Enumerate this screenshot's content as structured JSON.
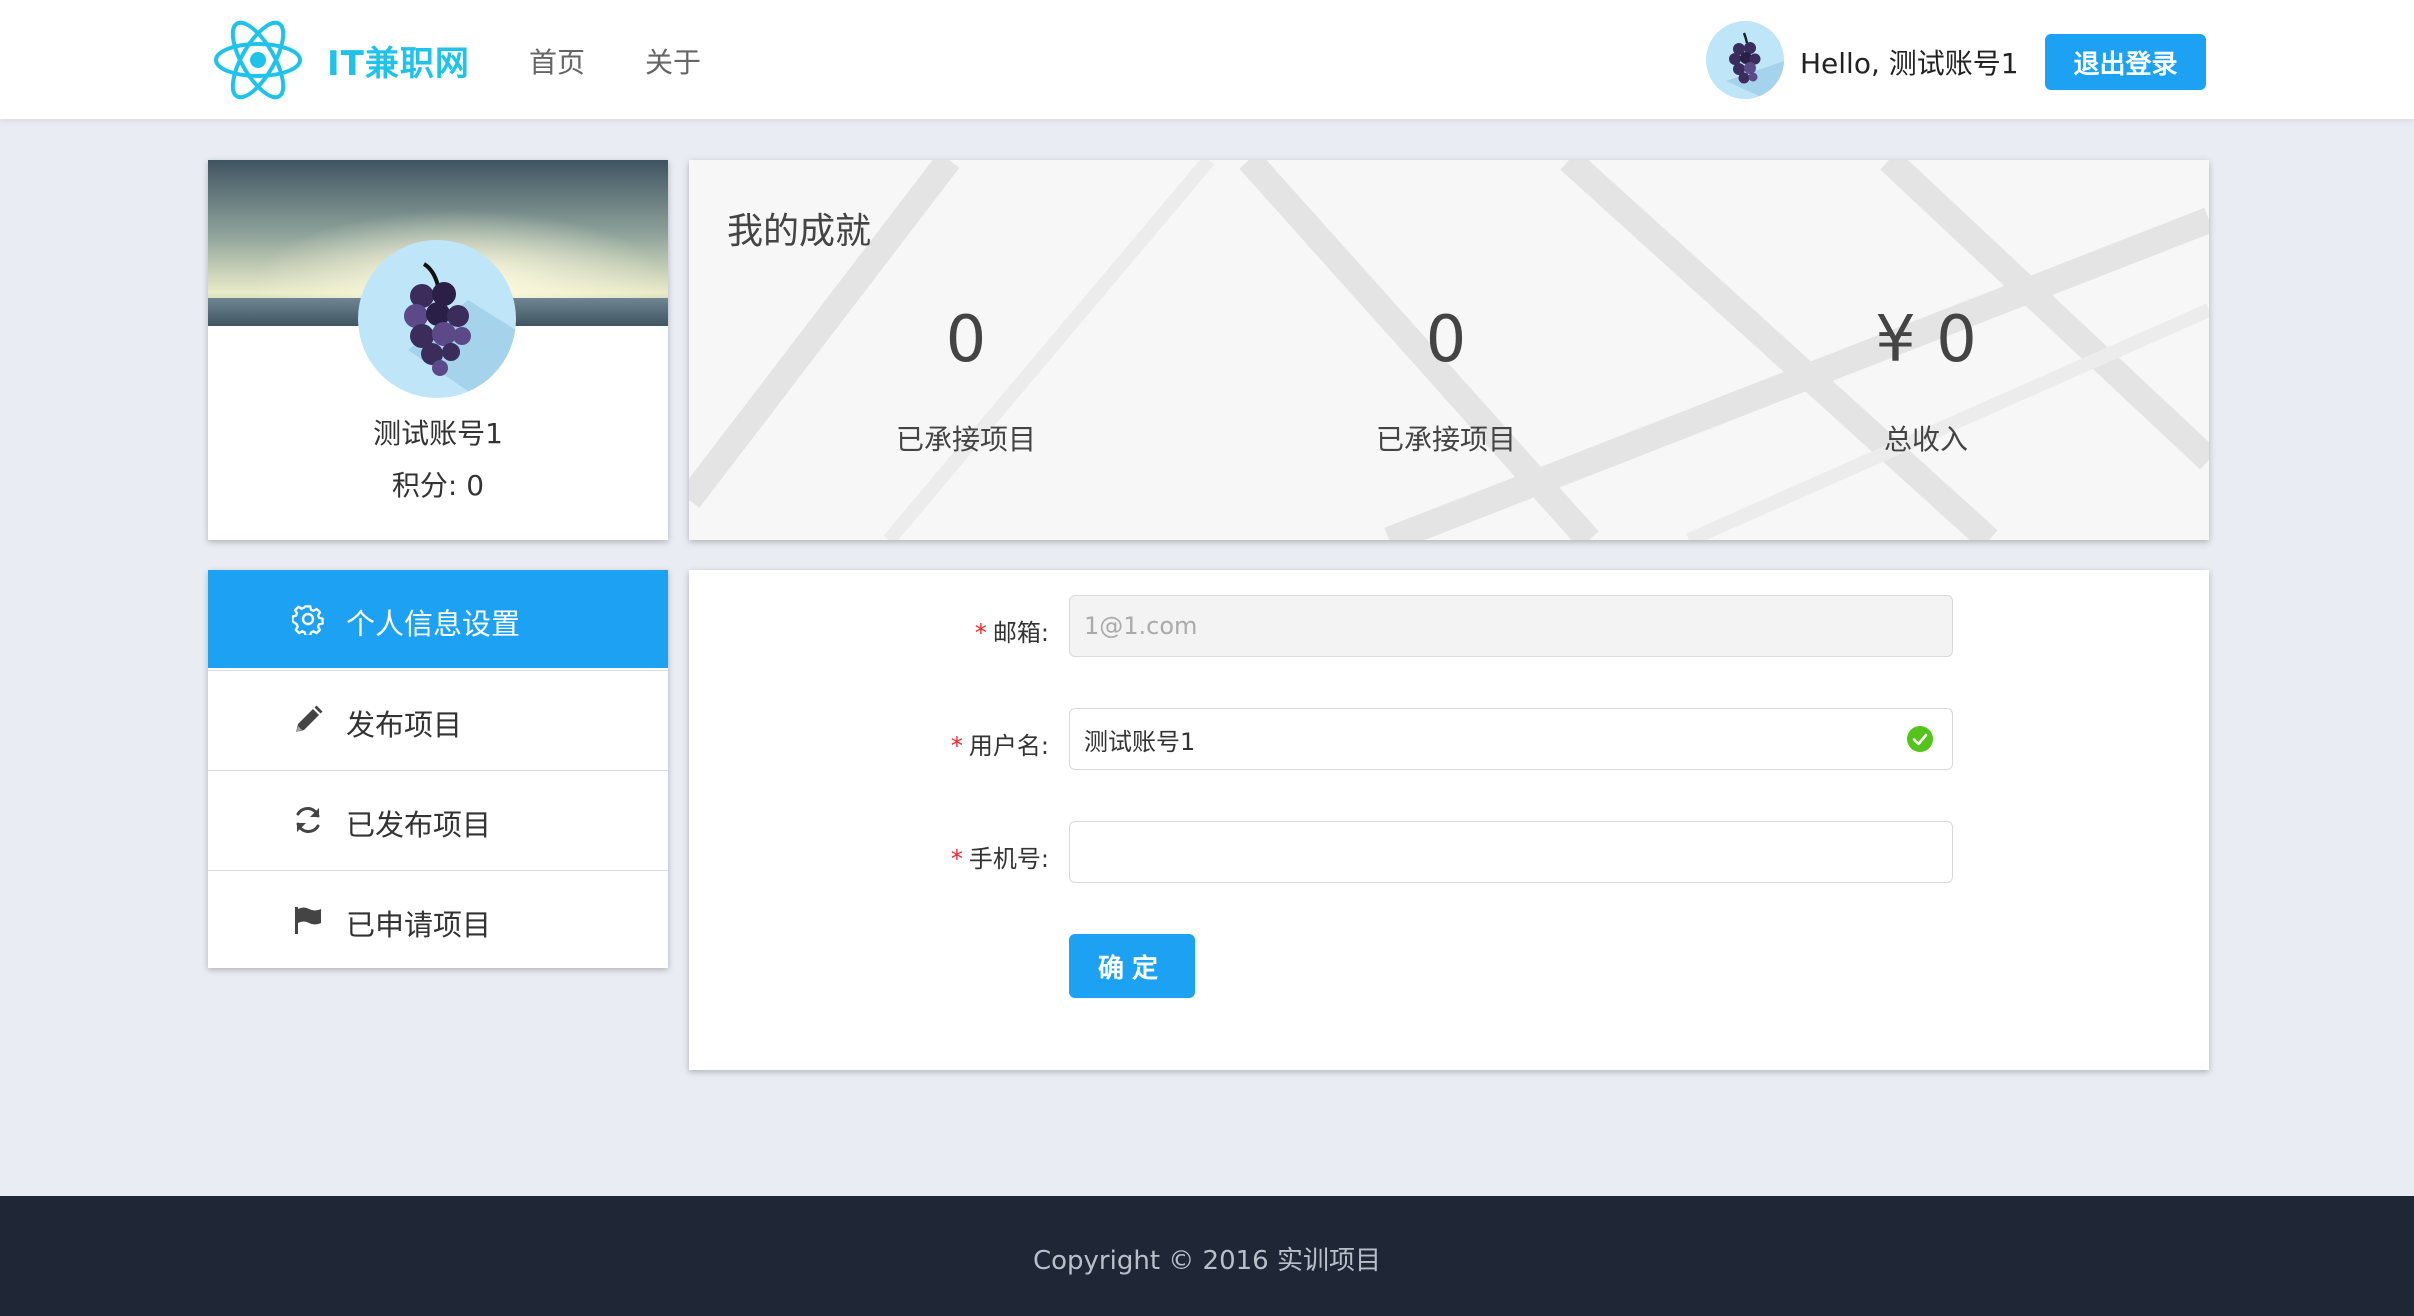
{
  "header": {
    "brand": "IT兼职网",
    "nav": [
      "首页",
      "关于"
    ],
    "greeting": "Hello, 测试账号1",
    "logout_label": "退出登录"
  },
  "profile": {
    "name": "测试账号1",
    "score_label": "积分: ",
    "score_value": "0"
  },
  "achievements": {
    "title": "我的成就",
    "stats": [
      {
        "value": "0",
        "label": "已承接项目"
      },
      {
        "value": "0",
        "label": "已承接项目"
      },
      {
        "value": "¥ 0",
        "label": "总收入"
      }
    ]
  },
  "menu": {
    "items": [
      {
        "label": "个人信息设置",
        "icon": "gear-icon",
        "active": true
      },
      {
        "label": "发布项目",
        "icon": "pencil-icon",
        "active": false
      },
      {
        "label": "已发布项目",
        "icon": "refresh-icon",
        "active": false
      },
      {
        "label": "已申请项目",
        "icon": "flag-icon",
        "active": false
      }
    ]
  },
  "form": {
    "required_mark": "*",
    "email_label": "邮箱:",
    "email_placeholder": "1@1.com",
    "username_label": "用户名:",
    "username_value": "测试账号1",
    "phone_label": "手机号:",
    "phone_value": "",
    "submit_label": "确定"
  },
  "footer": {
    "copyright": "Copyright © 2016 实训项目"
  },
  "colors": {
    "accent": "#1da1f2",
    "brand": "#1fc3ea",
    "footer_bg": "#1f2737",
    "page_bg": "#e9edf3",
    "success": "#52c41a",
    "required": "#f5222d"
  }
}
